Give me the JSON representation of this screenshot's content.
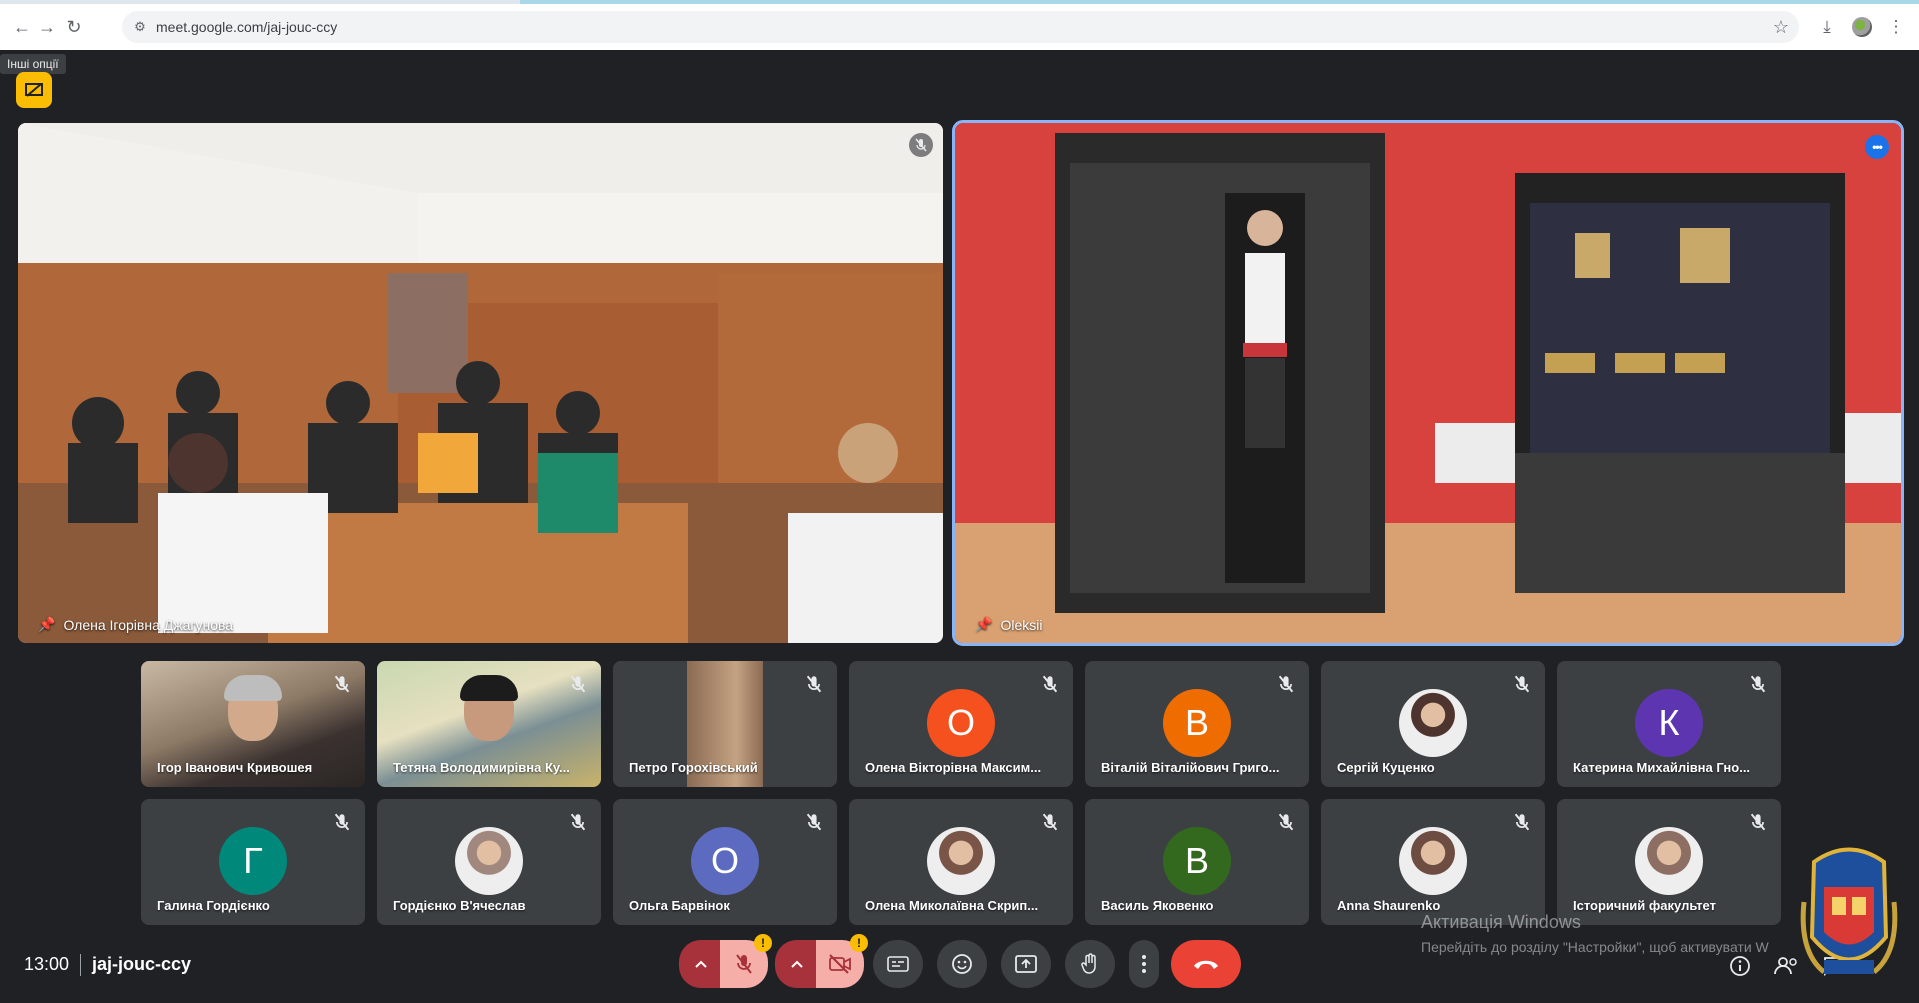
{
  "browser": {
    "url": "meet.google.com/jaj-jouc-ccy"
  },
  "tooltip": "Інші опції",
  "main_tiles": [
    {
      "name": "Олена Ігорівна Джагунова"
    },
    {
      "name": "Oleksii"
    }
  ],
  "participants": [
    {
      "name": "Ігор Іванович Кривошея",
      "type": "video"
    },
    {
      "name": "Тетяна Володимирівна Ку...",
      "type": "video"
    },
    {
      "name": "Петро Горохівський",
      "type": "video"
    },
    {
      "name": "Олена Вікторівна Максим...",
      "type": "letter",
      "letter": "О",
      "color": "#f4511e"
    },
    {
      "name": "Віталій Віталійович Григо...",
      "type": "letter",
      "letter": "В",
      "color": "#ef6c00"
    },
    {
      "name": "Сергій Куценко",
      "type": "photo"
    },
    {
      "name": "Катерина Михайлівна Гно...",
      "type": "letter",
      "letter": "К",
      "color": "#5e35b1"
    },
    {
      "name": "Галина Гордієнко",
      "type": "letter",
      "letter": "Г",
      "color": "#00897b"
    },
    {
      "name": "Гордієнко В'ячеслав",
      "type": "photo"
    },
    {
      "name": "Ольга Барвінок",
      "type": "letter",
      "letter": "О",
      "color": "#5c6bc0"
    },
    {
      "name": "Олена Миколаївна Скрип...",
      "type": "photo"
    },
    {
      "name": "Василь Яковенко",
      "type": "letter",
      "letter": "В",
      "color": "#33691e"
    },
    {
      "name": "Anna Shaurenko",
      "type": "photo"
    },
    {
      "name": "Історичний факультет",
      "type": "photo"
    }
  ],
  "meeting": {
    "time": "13:00",
    "code": "jaj-jouc-ccy"
  },
  "warnings": {
    "mic": "!",
    "cam": "!"
  },
  "windows_activation": {
    "title": "Активація Windows",
    "subtitle": "Перейдіть до розділу \"Настройки\", щоб активувати W"
  },
  "icons": {
    "back": "arrow-left",
    "forward": "arrow-right",
    "reload": "reload",
    "star": "star",
    "download": "download",
    "menu": "kebab"
  }
}
